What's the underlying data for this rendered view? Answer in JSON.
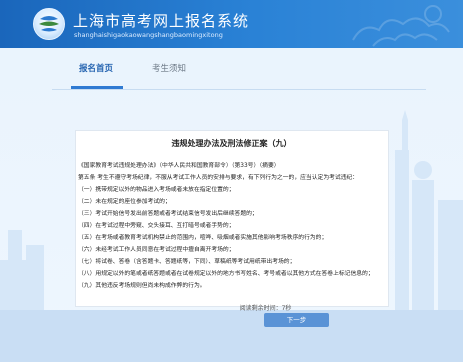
{
  "header": {
    "title": "上海市高考网上报名系统",
    "subtitle": "shanghaishigaokaowangshangbaomingxitong"
  },
  "tabs": [
    {
      "label": "报名首页",
      "active": true
    },
    {
      "label": "考生须知",
      "active": false
    }
  ],
  "notice": {
    "title": "违规处理办法及刑法修正案（九）",
    "lines": [
      "《国家教育考试违规处理办法》（中华人民共和国教育部令）（第33号）（摘要）",
      "第五条  考生不遵守考场纪律，不服从考试工作人员的安排与要求，有下列行为之一的，应当认定为考试违纪：",
      "（一）携带规定以外的物品进入考场或者未放在指定位置的；",
      "（二）未在规定的座位参加考试的；",
      "（三）考试开始信号发出前答题或者考试结束信号发出后继续答题的；",
      "（四）在考试过程中旁窥、交头接耳、互打暗号或者手势的；",
      "（五）在考场或者教育考试机构禁止的范围内，喧哗、吸烟或者实施其他影响考场秩序的行为的；",
      "（六）未经考试工作人员同意在考试过程中擅自离开考场的；",
      "（七）将试卷、答卷（含答题卡、答题纸等，下同）、草稿纸等考试用纸带出考场的；",
      "（八）用规定以外的笔或者纸答题或者在试卷规定以外的地方书写姓名、考号或者以其他方式在答卷上标记信息的；",
      "（九）其他违反考场规则但尚未构成作弊的行为。"
    ]
  },
  "footer": {
    "timer_text": "阅读剩余时间：7秒",
    "next_label": "下一步"
  }
}
